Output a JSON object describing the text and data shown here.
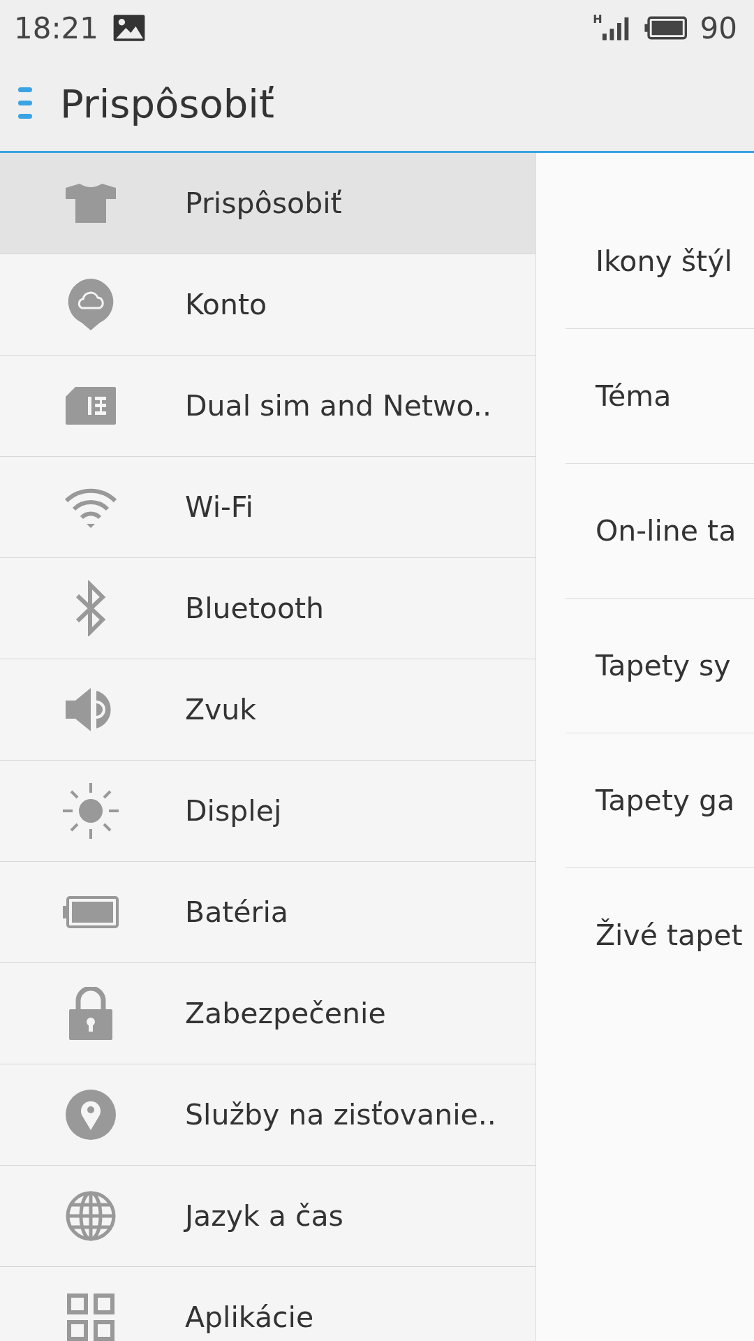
{
  "status_bar": {
    "time": "18:21",
    "network": "H",
    "battery": "90"
  },
  "header": {
    "title": "Prispôsobiť"
  },
  "sidebar": {
    "items": [
      {
        "label": "Prispôsobiť",
        "selected": true
      },
      {
        "label": "Konto",
        "selected": false
      },
      {
        "label": "Dual sim and Netwo..",
        "selected": false
      },
      {
        "label": "Wi-Fi",
        "selected": false
      },
      {
        "label": "Bluetooth",
        "selected": false
      },
      {
        "label": "Zvuk",
        "selected": false
      },
      {
        "label": "Displej",
        "selected": false
      },
      {
        "label": "Batéria",
        "selected": false
      },
      {
        "label": "Zabezpečenie",
        "selected": false
      },
      {
        "label": "Služby na zisťovanie..",
        "selected": false
      },
      {
        "label": "Jazyk a čas",
        "selected": false
      },
      {
        "label": "Aplikácie",
        "selected": false
      }
    ]
  },
  "detail": {
    "items": [
      "Ikony štýl",
      "Téma",
      "On-line ta",
      "Tapety sy",
      "Tapety ga",
      "Živé tapet"
    ]
  }
}
